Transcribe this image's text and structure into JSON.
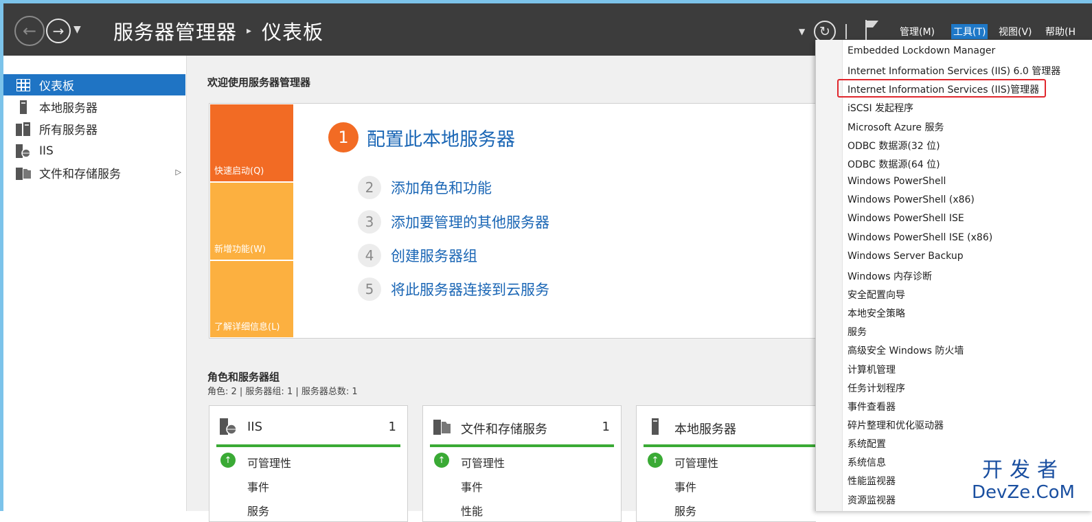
{
  "titlebar": {
    "app": "服务器管理器",
    "separator": "▸",
    "page": "仪表板",
    "menus": [
      "管理(M)",
      "工具(T)",
      "视图(V)",
      "帮助(H"
    ]
  },
  "sidebar": {
    "items": [
      {
        "label": "仪表板",
        "icon": "dashboard-icon",
        "active": true
      },
      {
        "label": "本地服务器",
        "icon": "server-icon"
      },
      {
        "label": "所有服务器",
        "icon": "servers-icon"
      },
      {
        "label": "IIS",
        "icon": "iis-icon"
      },
      {
        "label": "文件和存储服务",
        "icon": "file-storage-icon",
        "has_arrow": true
      }
    ]
  },
  "main": {
    "welcome_title": "欢迎使用服务器管理器",
    "tiles": [
      "快速启动(Q)",
      "新增功能(W)",
      "了解详细信息(L)"
    ],
    "steps": [
      {
        "num": "1",
        "label": "配置此本地服务器"
      },
      {
        "num": "2",
        "label": "添加角色和功能"
      },
      {
        "num": "3",
        "label": "添加要管理的其他服务器"
      },
      {
        "num": "4",
        "label": "创建服务器组"
      },
      {
        "num": "5",
        "label": "将此服务器连接到云服务"
      }
    ],
    "roles_title": "角色和服务器组",
    "roles_summary": "角色: 2 | 服务器组: 1 | 服务器总数: 1",
    "cards": [
      {
        "title": "IIS",
        "count": "1",
        "rows": [
          "可管理性",
          "事件",
          "服务"
        ]
      },
      {
        "title": "文件和存储服务",
        "count": "1",
        "rows": [
          "可管理性",
          "事件",
          "性能"
        ]
      },
      {
        "title": "本地服务器",
        "count": "",
        "rows": [
          "可管理性",
          "事件",
          "服务"
        ]
      }
    ]
  },
  "tools_menu": {
    "items": [
      "Embedded Lockdown Manager",
      "Internet Information Services (IIS) 6.0 管理器",
      "Internet Information Services (IIS)管理器",
      "iSCSI 发起程序",
      "Microsoft Azure 服务",
      "ODBC 数据源(32 位)",
      "ODBC 数据源(64 位)",
      "Windows PowerShell",
      "Windows PowerShell (x86)",
      "Windows PowerShell ISE",
      "Windows PowerShell ISE (x86)",
      "Windows Server Backup",
      "Windows 内存诊断",
      "安全配置向导",
      "本地安全策略",
      "服务",
      "高级安全 Windows 防火墙",
      "计算机管理",
      "任务计划程序",
      "事件查看器",
      "碎片整理和优化驱动器",
      "系统配置",
      "系统信息",
      "性能监视器",
      "资源监视器"
    ],
    "highlighted_index": 2
  },
  "watermark": {
    "line1": "开发者",
    "line2": "DevZe.CoM"
  },
  "colors": {
    "accent": "#1f74c4",
    "orange": "#f26b24",
    "amber": "#fcb040",
    "green": "#3aaa35",
    "highlight_border": "#e0262c"
  }
}
